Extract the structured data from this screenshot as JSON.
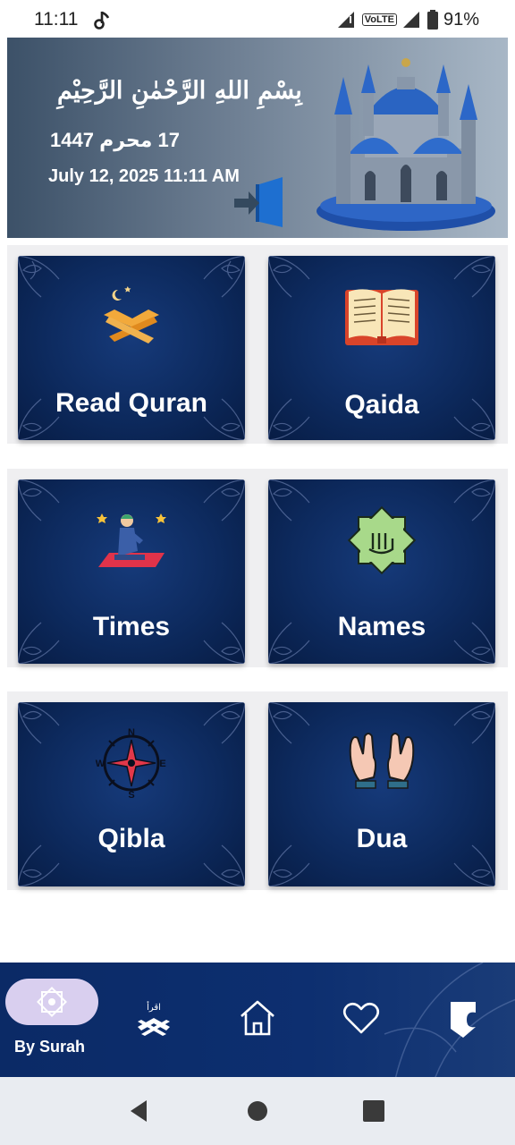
{
  "status_bar": {
    "time": "11:11",
    "volte": "VoLTE",
    "battery": "91%"
  },
  "header": {
    "bismillah": "بِسْمِ اللهِ الرَّحْمٰنِ الرَّحِيْمِ",
    "hijri_date": "17 محرم 1447",
    "gregorian_datetime": "July 12, 2025 11:11 AM",
    "icons": [
      "login-icon",
      "mosque-illustration"
    ]
  },
  "menu": [
    {
      "label": "Read Quran",
      "icon": "quran-stand-icon"
    },
    {
      "label": "Qaida",
      "icon": "open-book-icon"
    },
    {
      "label": "Times",
      "icon": "praying-man-icon"
    },
    {
      "label": "Names",
      "icon": "allah-star-icon"
    },
    {
      "label": "Qibla",
      "icon": "compass-icon"
    },
    {
      "label": "Dua",
      "icon": "dua-hands-icon"
    }
  ],
  "compass_letters": {
    "n": "N",
    "e": "E",
    "s": "S",
    "w": "W"
  },
  "bottom_nav": {
    "active_label": "By Surah",
    "read_glyph": "اقرأ",
    "items": [
      "by-surah-icon",
      "read-quran-nav-icon",
      "home-icon",
      "heart-icon",
      "bookmark-icon"
    ]
  },
  "colors": {
    "card_bg": "#0d2a5e",
    "nav_bg": "#0b2a66",
    "active_pill": "#d9cfef"
  }
}
